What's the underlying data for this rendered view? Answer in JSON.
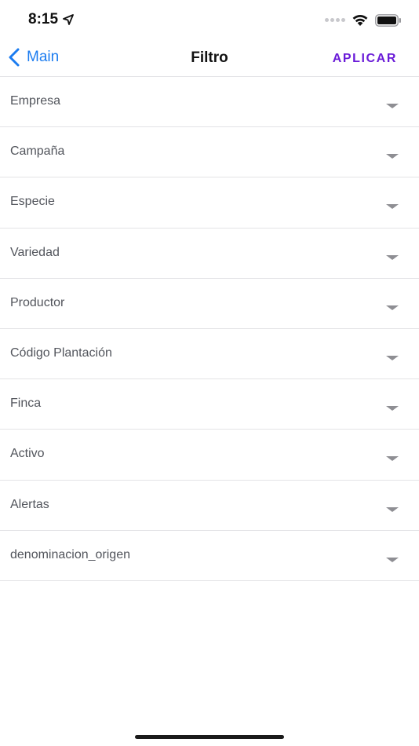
{
  "status_bar": {
    "time": "8:15",
    "icons": [
      "location-arrow-icon",
      "signal-dots-icon",
      "wifi-icon",
      "battery-icon"
    ]
  },
  "nav": {
    "back_label": "Main",
    "title": "Filtro",
    "apply_label": "APLICAR"
  },
  "colors": {
    "back_link": "#1b7cf0",
    "apply_action": "#6a1bd8",
    "label_text": "#52555c",
    "divider": "#e3e3e6",
    "chevron": "#8e8e93"
  },
  "filters": [
    {
      "label": "Empresa"
    },
    {
      "label": "Campaña"
    },
    {
      "label": "Especie"
    },
    {
      "label": "Variedad"
    },
    {
      "label": "Productor"
    },
    {
      "label": "Código Plantación"
    },
    {
      "label": "Finca"
    },
    {
      "label": "Activo"
    },
    {
      "label": "Alertas"
    },
    {
      "label": "denominacion_origen"
    }
  ]
}
